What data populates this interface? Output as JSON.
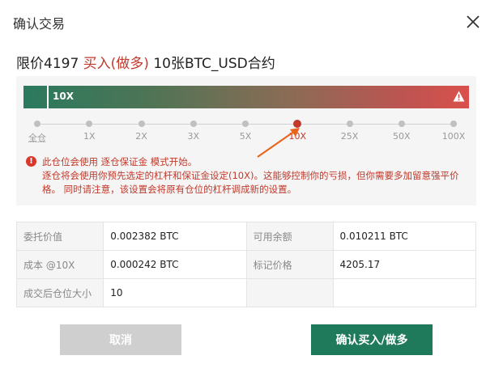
{
  "dialog": {
    "title": "确认交易",
    "close_icon": "close-icon"
  },
  "summary": {
    "price_label": "限价4197",
    "side": "买入(做多)",
    "contract": "10张BTC_USD合约"
  },
  "leverage": {
    "current_label": "10X",
    "current_value": 10,
    "warning_icon": "warning-triangle-icon",
    "options": [
      "全仓",
      "1X",
      "2X",
      "3X",
      "5X",
      "10X",
      "25X",
      "50X",
      "100X"
    ],
    "selected_index": 5
  },
  "notice": {
    "icon": "error-circle-icon",
    "line1": "此仓位会使用 逐仓保证金 模式开始。",
    "line2": "逐仓将会使用你预先选定的杠杆和保证金设定(10X)。这能够控制你的亏损，但你需要多加留意强平价格。 同时请注意，该设置会将原有仓位的杠杆调成新的设置。"
  },
  "details": {
    "rows": [
      [
        {
          "k": "委托价值",
          "v": "0.002382 BTC"
        },
        {
          "k": "可用余额",
          "v": "0.010211 BTC"
        }
      ],
      [
        {
          "k": "成本 @10X",
          "v": "0.000242 BTC"
        },
        {
          "k": "标记价格",
          "v": "4205.17"
        }
      ],
      [
        {
          "k": "成交后仓位大小",
          "v": "10"
        },
        {
          "k": "",
          "v": ""
        }
      ]
    ]
  },
  "buttons": {
    "cancel": "取消",
    "confirm": "确认买入/做多"
  },
  "colors": {
    "accent_green": "#1f7a5c",
    "danger_red": "#c0392b",
    "muted_gray": "#cfcfcf"
  }
}
